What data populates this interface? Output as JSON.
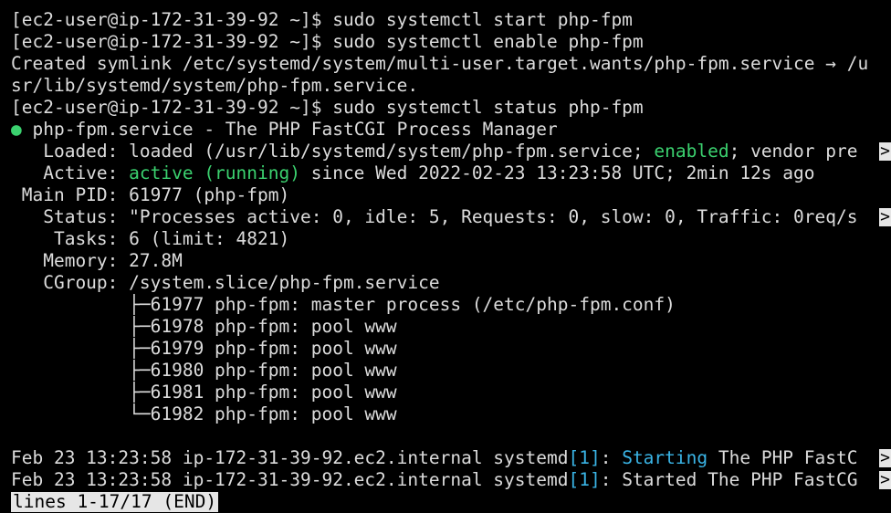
{
  "lines": [
    {
      "prompt": "[ec2-user@ip-172-31-39-92 ~]$ ",
      "cmd": "sudo systemctl start php-fpm"
    },
    {
      "prompt": "[ec2-user@ip-172-31-39-92 ~]$ ",
      "cmd": "sudo systemctl enable php-fpm"
    },
    {
      "text": "Created symlink /etc/systemd/system/multi-user.target.wants/php-fpm.service → /u"
    },
    {
      "text": "sr/lib/systemd/system/php-fpm.service."
    },
    {
      "prompt": "[ec2-user@ip-172-31-39-92 ~]$ ",
      "cmd": "sudo systemctl status php-fpm"
    }
  ],
  "status": {
    "dot": "●",
    "unit_line": " php-fpm.service - The PHP FastCGI Process Manager",
    "loaded_pre": "   Loaded: loaded (/usr/lib/systemd/system/php-fpm.service; ",
    "loaded_enabled": "enabled",
    "loaded_post": "; vendor pre",
    "active_pre": "   Active: ",
    "active_state": "active (running)",
    "active_post": " since Wed 2022-02-23 13:23:58 UTC; 2min 12s ago",
    "main_pid": " Main PID: 61977 (php-fpm)",
    "status_line": "   Status: \"Processes active: 0, idle: 5, Requests: 0, slow: 0, Traffic: 0req/s",
    "tasks": "    Tasks: 6 (limit: 4821)",
    "memory": "   Memory: 27.8M",
    "cgroup": "   CGroup: /system.slice/php-fpm.service",
    "tree": [
      "           ├─61977 php-fpm: master process (/etc/php-fpm.conf)",
      "           ├─61978 php-fpm: pool www",
      "           ├─61979 php-fpm: pool www",
      "           ├─61980 php-fpm: pool www",
      "           ├─61981 php-fpm: pool www",
      "           └─61982 php-fpm: pool www"
    ]
  },
  "log": [
    {
      "pre": "Feb 23 13:23:58 ip-172-31-39-92.ec2.internal systemd",
      "pid": "[1]",
      "sep": ": ",
      "word": "Starting",
      "rest": " The PHP FastC"
    },
    {
      "pre": "Feb 23 13:23:58 ip-172-31-39-92.ec2.internal systemd",
      "pid": "[1]",
      "sep": ": ",
      "word": "",
      "rest": "Started The PHP FastCG"
    }
  ],
  "trunc_marker": ">",
  "pager": "lines 1-17/17 (END)"
}
